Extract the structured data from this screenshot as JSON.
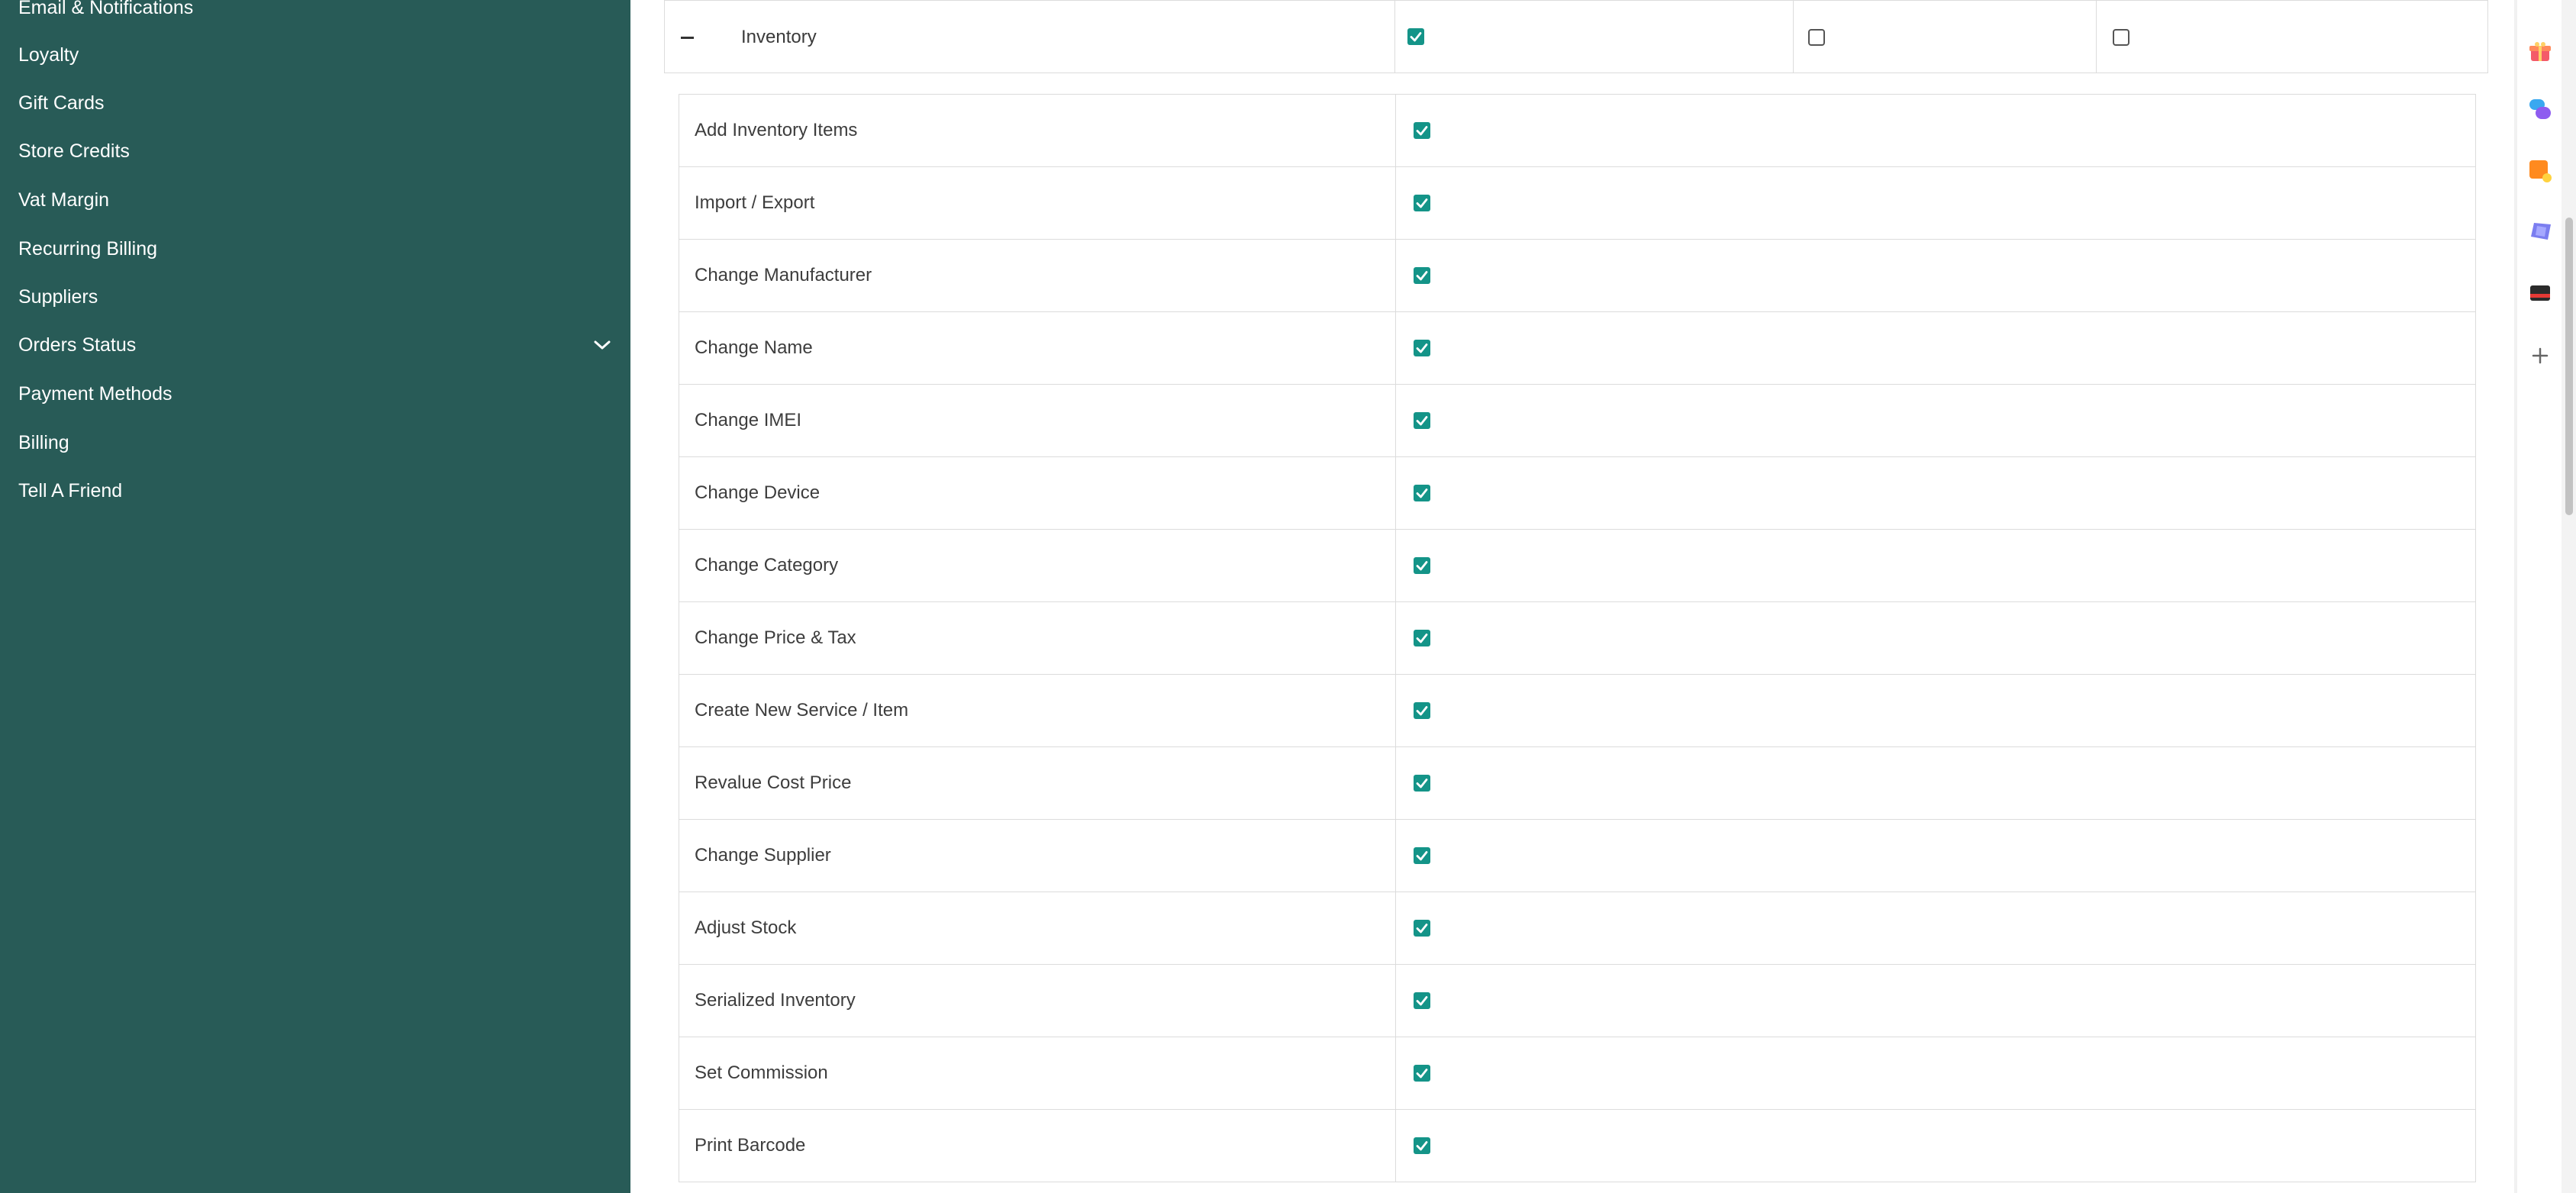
{
  "sidebar": {
    "items": [
      {
        "label": "Email & Notifications"
      },
      {
        "label": "Loyalty"
      },
      {
        "label": "Gift Cards"
      },
      {
        "label": "Store Credits"
      },
      {
        "label": "Vat Margin"
      },
      {
        "label": "Recurring Billing"
      },
      {
        "label": "Suppliers"
      },
      {
        "label": "Orders Status",
        "icon": "chevron-down-icon"
      },
      {
        "label": "Payment Methods"
      },
      {
        "label": "Billing"
      },
      {
        "label": "Tell A Friend"
      }
    ]
  },
  "permissions": {
    "group": {
      "label": "Inventory",
      "columns": [
        {
          "checked": true
        },
        {
          "checked": false
        },
        {
          "checked": false
        }
      ]
    },
    "rows": [
      {
        "label": "Add Inventory Items",
        "checked": true
      },
      {
        "label": "Import / Export",
        "checked": true
      },
      {
        "label": "Change Manufacturer",
        "checked": true
      },
      {
        "label": "Change Name",
        "checked": true
      },
      {
        "label": "Change IMEI",
        "checked": true
      },
      {
        "label": "Change Device",
        "checked": true
      },
      {
        "label": "Change Category",
        "checked": true
      },
      {
        "label": "Change Price & Tax",
        "checked": true
      },
      {
        "label": "Create New Service / Item",
        "checked": true
      },
      {
        "label": "Revalue Cost Price",
        "checked": true
      },
      {
        "label": "Change Supplier",
        "checked": true
      },
      {
        "label": "Adjust Stock",
        "checked": true
      },
      {
        "label": "Serialized Inventory",
        "checked": true
      },
      {
        "label": "Set Commission",
        "checked": true
      },
      {
        "label": "Print Barcode",
        "checked": true
      }
    ]
  },
  "right_rail": {
    "icons": [
      "gift-icon",
      "chat-bubbles-icon",
      "note-icon",
      "shapes-icon",
      "card-icon",
      "plus-icon"
    ]
  },
  "colors": {
    "sidebar_bg": "#285b57",
    "checkbox_on": "#149488"
  }
}
